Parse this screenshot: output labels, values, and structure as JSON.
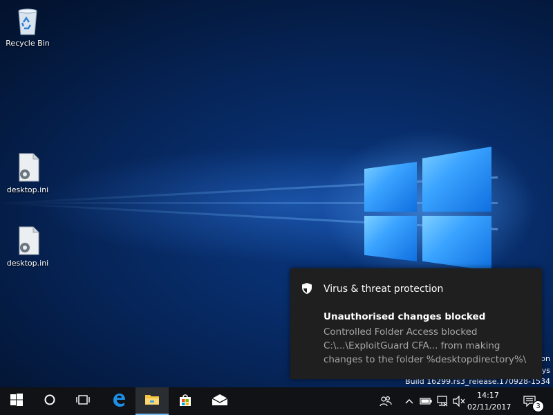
{
  "desktop": {
    "icons": [
      {
        "label": "Recycle Bin"
      },
      {
        "label": "desktop.ini"
      },
      {
        "label": "desktop.ini"
      }
    ],
    "watermark": {
      "line1": "on",
      "line2": "ys",
      "line3": "Build 16299.rs3_release.170928-1534"
    }
  },
  "toast": {
    "app_name": "Virus & threat protection",
    "title": "Unauthorised changes blocked",
    "body": "Controlled Folder Access blocked C:\\...\\ExploitGuard CFA... from making changes to the folder %desktopdirectory%\\"
  },
  "taskbar": {
    "pinned": [
      "start-icon",
      "cortana-icon",
      "task-view-icon",
      "edge-icon",
      "file-explorer-icon",
      "store-icon",
      "mail-icon"
    ],
    "tray": [
      "people-icon",
      "chevron-up-icon",
      "battery-icon",
      "network-icon",
      "volume-muted-icon"
    ],
    "clock": {
      "time": "14:17",
      "date": "02/11/2017"
    },
    "notifications_count": "3",
    "accent": "#76b9ed"
  }
}
